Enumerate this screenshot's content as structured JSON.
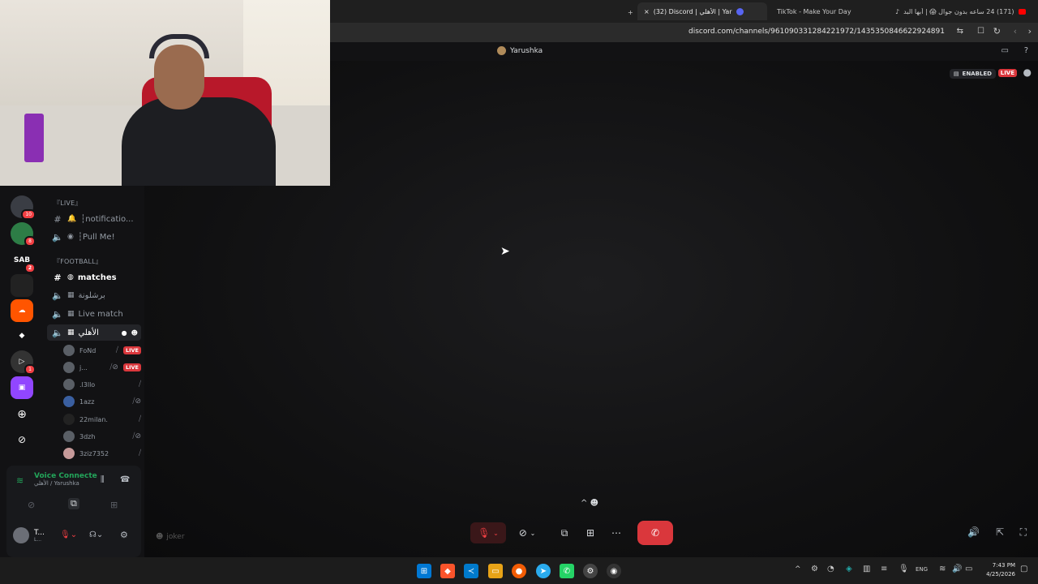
{
  "browser": {
    "tabs": [
      {
        "label": "(32) Discord | ⁨الأهلي⁩ | Yar",
        "active": true
      },
      {
        "label": "TikTok - Make Your Day",
        "active": false
      },
      {
        "label": "(171) 24 ساعه بدون جوال 😱 | أبها البد",
        "active": false
      }
    ],
    "new_tab": "+",
    "close": "×",
    "url": "discord.com/channels/961090331284221972/1435350846622924891"
  },
  "discord": {
    "title": "Yarushka",
    "stage": {
      "enabled_label": "ENABLED",
      "live_label": "LIVE"
    },
    "guilds": [
      {
        "name": "server-1",
        "badge": "10",
        "color": "#3a3d44"
      },
      {
        "name": "server-2",
        "badge": "8",
        "color": "#2d7d46"
      },
      {
        "name": "SAB",
        "badge": "2",
        "color": "#121214"
      },
      {
        "name": "server-4",
        "badge": "",
        "color": "#222"
      },
      {
        "name": "soundcloud",
        "badge": "",
        "color": "#ff5500"
      },
      {
        "name": "server-6",
        "badge": "",
        "color": "#121214"
      },
      {
        "name": "server-7",
        "badge": "1",
        "color": "#333"
      },
      {
        "name": "twitch",
        "badge": "",
        "color": "#9146ff"
      },
      {
        "name": "add-server",
        "badge": "",
        "color": "#121214"
      },
      {
        "name": "discover",
        "badge": "",
        "color": "#121214"
      }
    ],
    "channels": {
      "cat_live": "『LIVE』",
      "notifications": "┆notificatio...",
      "pull_me": "┆Pull Me!",
      "cat_football": "『FOOTBALL』",
      "matches": "matches",
      "br_shulwa": "برشلونة",
      "live_match": "Live match",
      "alahly": "الأهلي",
      "members": [
        {
          "name": "FoNd",
          "live": true
        },
        {
          "name": "j...",
          "live": true
        },
        {
          "name": ".l3llo",
          "live": false
        },
        {
          "name": "1azz",
          "live": false
        },
        {
          "name": "22milan.",
          "live": false
        },
        {
          "name": "3dzh",
          "live": false
        },
        {
          "name": "3ziz7352",
          "live": false
        }
      ],
      "live_tag": "LIVE"
    },
    "voice": {
      "status": "Voice Connecte",
      "location": "الأهلي / Yarushka"
    },
    "user": {
      "name": "T...",
      "sub": "L..."
    },
    "joker": "joker"
  },
  "taskbar": {
    "lang": "ENG",
    "time": "7:43 PM",
    "date": "4/25/2026"
  }
}
